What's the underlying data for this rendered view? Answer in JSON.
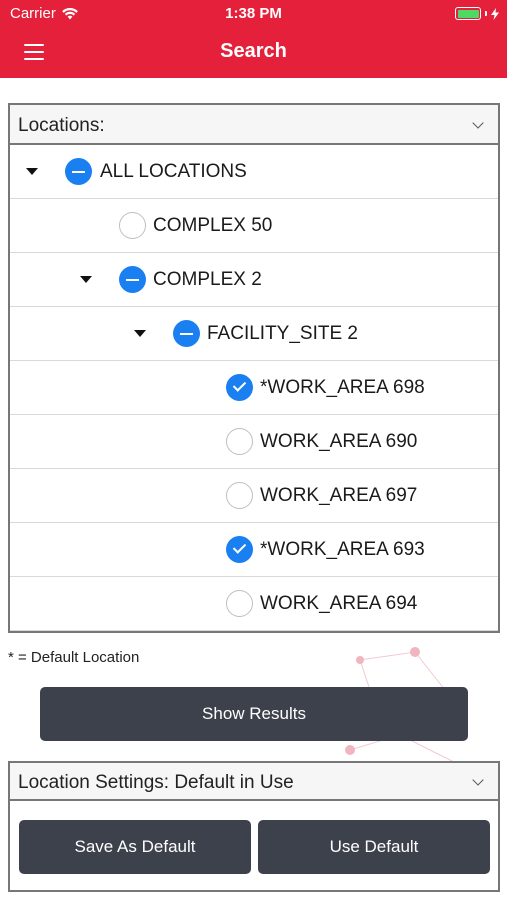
{
  "status_bar": {
    "carrier": "Carrier",
    "time": "1:38 PM"
  },
  "nav": {
    "title": "Search",
    "menu_icon": "hamburger-menu-icon"
  },
  "locations": {
    "header_label": "Locations:",
    "tree": [
      {
        "label": "ALL LOCATIONS",
        "state": "partial",
        "expanded": true
      },
      {
        "label": "COMPLEX 50",
        "state": "unchecked",
        "expanded": false
      },
      {
        "label": "COMPLEX 2",
        "state": "partial",
        "expanded": true
      },
      {
        "label": "FACILITY_SITE 2",
        "state": "partial",
        "expanded": true
      },
      {
        "label": "*WORK_AREA 698",
        "state": "checked"
      },
      {
        "label": "WORK_AREA 690",
        "state": "unchecked"
      },
      {
        "label": "WORK_AREA 697",
        "state": "unchecked"
      },
      {
        "label": "*WORK_AREA 693",
        "state": "checked"
      },
      {
        "label": "WORK_AREA 694",
        "state": "unchecked"
      }
    ]
  },
  "legend": "* = Default Location",
  "show_results_label": "Show Results",
  "settings": {
    "header_label": "Location Settings: Default in Use",
    "save_default_label": "Save As Default",
    "use_default_label": "Use Default"
  },
  "colors": {
    "header_red": "#e5203a",
    "selection_blue": "#1a7ff0",
    "button_dark": "#3d414c",
    "battery_green": "#4cd964"
  }
}
